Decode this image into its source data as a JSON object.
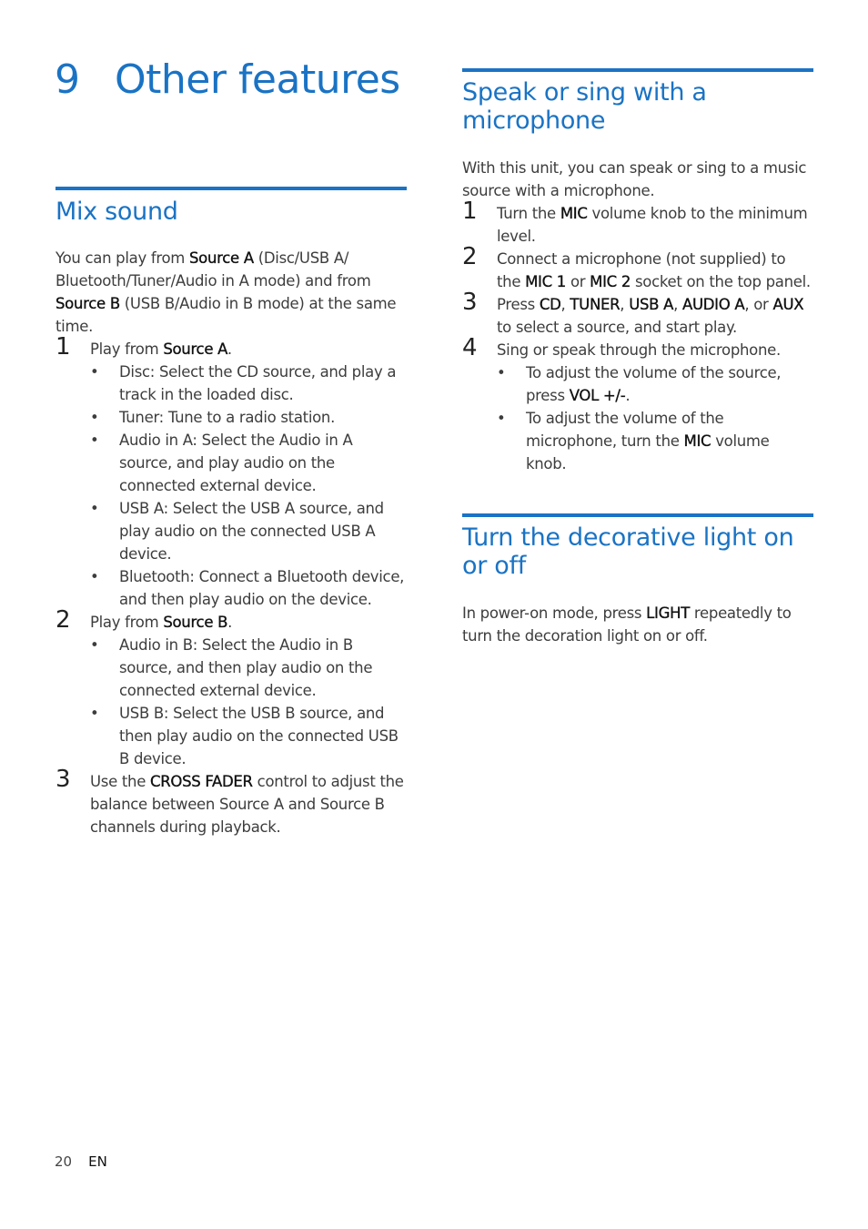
{
  "chapter": {
    "number": "9",
    "title": "Other features"
  },
  "colors": {
    "accent": "#1a73c4",
    "body_text": "#3d3d3d"
  },
  "sections": {
    "mix_sound": {
      "heading": "Mix sound",
      "intro": [
        {
          "t": "You can play from "
        },
        {
          "t": "Source A",
          "b": true
        },
        {
          "t": " (Disc/USB A/ Bluetooth/Tuner/Audio in A mode) and from "
        },
        {
          "t": "Source B",
          "b": true
        },
        {
          "t": " (USB B/Audio in B mode) at the same time."
        }
      ],
      "steps": [
        {
          "num": "1",
          "text": [
            {
              "t": "Play from "
            },
            {
              "t": "Source A",
              "b": true
            },
            {
              "t": "."
            }
          ],
          "bullets": [
            [
              {
                "t": "Disc: Select the CD source, and play a track in the loaded disc."
              }
            ],
            [
              {
                "t": "Tuner: Tune to a radio station."
              }
            ],
            [
              {
                "t": "Audio in A: Select the Audio in A source, and play audio on the connected external device."
              }
            ],
            [
              {
                "t": "USB A: Select the USB A source, and play audio on the connected USB A device."
              }
            ],
            [
              {
                "t": "Bluetooth: Connect a Bluetooth device, and then play audio on the device."
              }
            ]
          ]
        },
        {
          "num": "2",
          "text": [
            {
              "t": "Play from "
            },
            {
              "t": "Source B",
              "b": true
            },
            {
              "t": "."
            }
          ],
          "bullets": [
            [
              {
                "t": "Audio in B: Select the Audio in B source, and then play audio on the connected external device."
              }
            ],
            [
              {
                "t": "USB B: Select the USB B source, and then play audio on the connected USB B device."
              }
            ]
          ]
        },
        {
          "num": "3",
          "text": [
            {
              "t": "Use the "
            },
            {
              "t": "CROSS FADER",
              "b": true
            },
            {
              "t": " control to adjust the balance between Source A and Source B channels during playback."
            }
          ],
          "bullets": []
        }
      ]
    },
    "microphone": {
      "heading": "Speak or sing with a microphone",
      "intro": [
        {
          "t": "With this unit, you can speak or sing to a music source with a microphone."
        }
      ],
      "steps": [
        {
          "num": "1",
          "text": [
            {
              "t": "Turn the "
            },
            {
              "t": "MIC",
              "b": true
            },
            {
              "t": " volume knob to the minimum level."
            }
          ],
          "bullets": []
        },
        {
          "num": "2",
          "text": [
            {
              "t": "Connect a microphone (not supplied) to the "
            },
            {
              "t": "MIC 1",
              "b": true
            },
            {
              "t": " or "
            },
            {
              "t": "MIC 2",
              "b": true
            },
            {
              "t": " socket on the top panel."
            }
          ],
          "bullets": []
        },
        {
          "num": "3",
          "text": [
            {
              "t": "Press "
            },
            {
              "t": "CD",
              "b": true
            },
            {
              "t": ", "
            },
            {
              "t": "TUNER",
              "b": true
            },
            {
              "t": ", "
            },
            {
              "t": "USB A",
              "b": true
            },
            {
              "t": ", "
            },
            {
              "t": "AUDIO A",
              "b": true
            },
            {
              "t": ", or "
            },
            {
              "t": "AUX",
              "b": true
            },
            {
              "t": " to select a source, and start play."
            }
          ],
          "bullets": []
        },
        {
          "num": "4",
          "text": [
            {
              "t": "Sing or speak through the microphone."
            }
          ],
          "bullets": [
            [
              {
                "t": "To adjust the volume of the source, press "
              },
              {
                "t": "VOL +/-",
                "b": true
              },
              {
                "t": "."
              }
            ],
            [
              {
                "t": "To adjust the volume of the microphone, turn the "
              },
              {
                "t": "MIC",
                "b": true
              },
              {
                "t": " volume knob."
              }
            ]
          ]
        }
      ]
    },
    "light": {
      "heading": "Turn the decorative light on or off",
      "intro": [
        {
          "t": "In power-on mode, press "
        },
        {
          "t": "LIGHT",
          "b": true
        },
        {
          "t": " repeatedly to turn the decoration light on or off."
        }
      ],
      "steps": []
    }
  },
  "footer": {
    "page_number": "20",
    "language": "EN"
  }
}
